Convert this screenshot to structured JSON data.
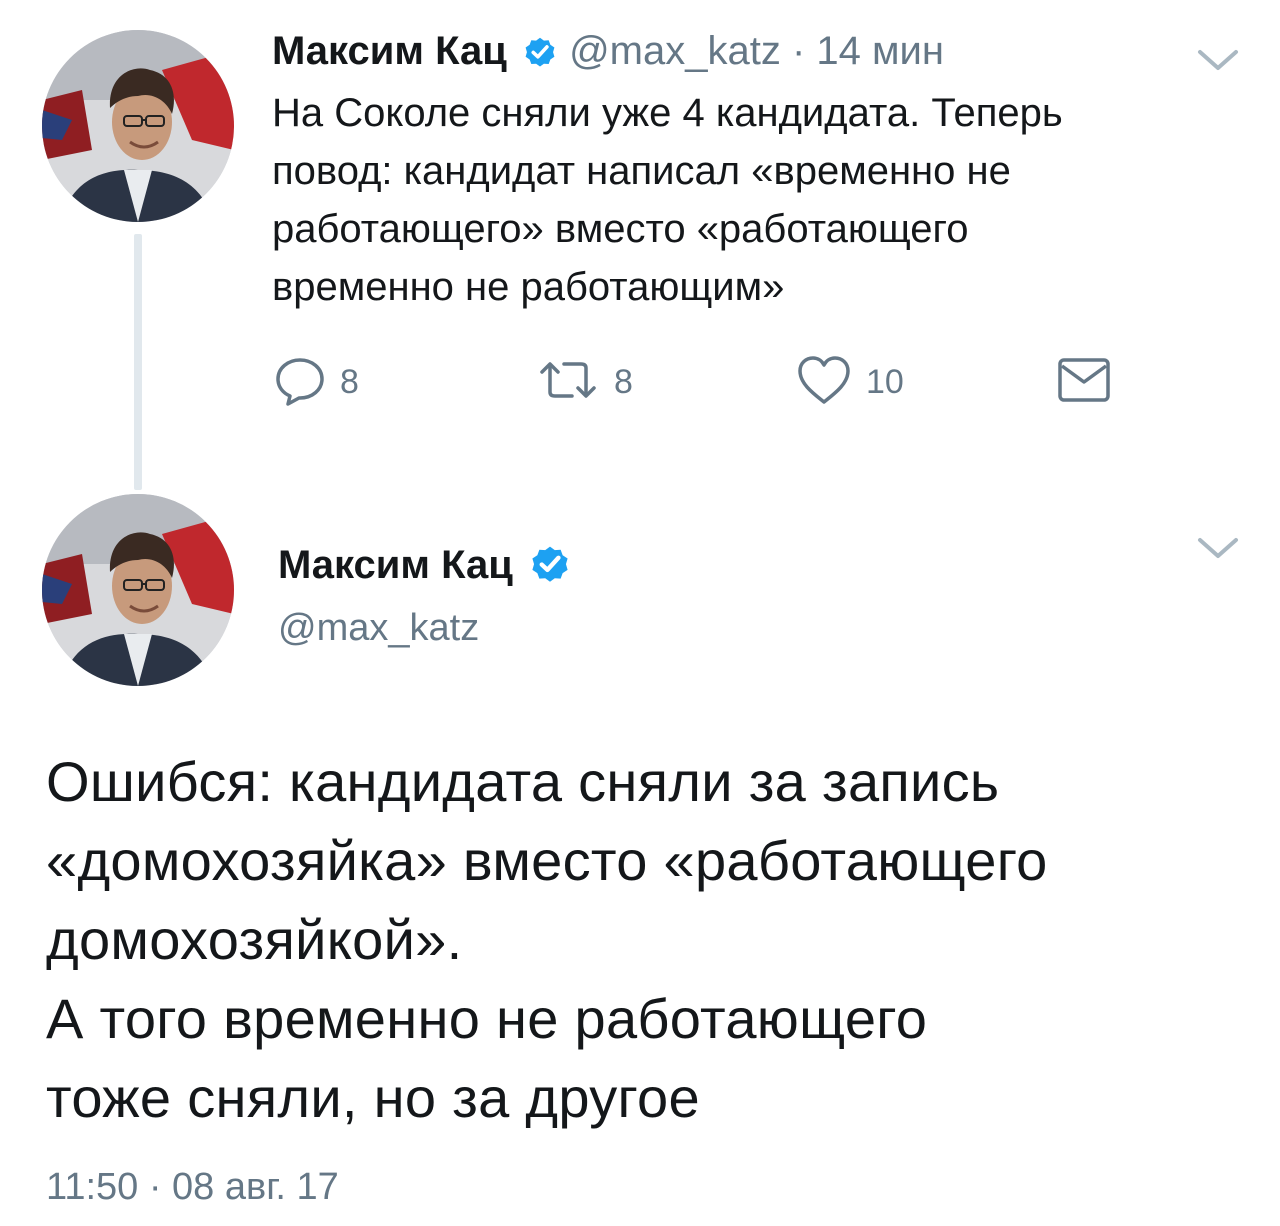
{
  "tweet1": {
    "author_name": "Максим Кац",
    "handle": "@max_katz",
    "separator": " · ",
    "time_ago": "14 мин",
    "text_lines": [
      "На Соколе сняли уже 4 кандидата. Теперь",
      "повод: кандидат написал «временно не",
      "работающего» вместо «работающего",
      "временно не работающим»"
    ],
    "actions": {
      "reply_count": "8",
      "retweet_count": "8",
      "like_count": "10"
    }
  },
  "tweet2": {
    "author_name": "Максим Кац",
    "handle": "@max_katz",
    "text_lines": [
      "Ошибся: кандидата сняли за запись",
      "«домохозяйка» вместо «работающего",
      "домохозяйкой».",
      "А того временно не работающего",
      "тоже сняли, но за другое"
    ],
    "timestamp": "11:50 · 08 авг. 17"
  },
  "icons": {
    "verified": "verified-badge-icon",
    "menu": "chevron-down-icon",
    "reply": "reply-icon",
    "retweet": "retweet-icon",
    "like": "heart-icon",
    "dm": "envelope-icon"
  },
  "colors": {
    "verified_blue": "#1da1f2",
    "muted_text": "#657786",
    "thread_line": "#e1e8ed",
    "text": "#14171a"
  }
}
